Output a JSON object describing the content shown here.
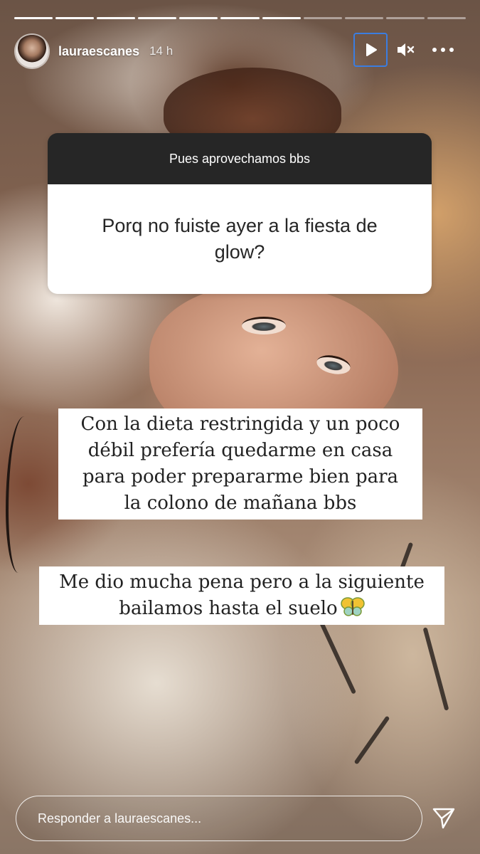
{
  "story": {
    "progress": {
      "segments_total": 11,
      "segments_viewed": 7
    },
    "header": {
      "username": "lauraescanes",
      "time_ago": "14 h",
      "play_icon": "play-icon",
      "mute_icon": "speaker-muted-icon",
      "more_icon": "more-horizontal-icon"
    },
    "question_sticker": {
      "prompt": "Pues aprovechamos bbs",
      "question": "Porq no fuiste ayer a la fiesta de glow?"
    },
    "captions": [
      "Con la dieta restringida y un poco",
      "débil prefería quedarme en casa",
      "para poder prepararme bien para",
      "la colono de mañana bbs",
      "Me dio mucha pena pero a la siguiente",
      "bailamos hasta el suelo"
    ],
    "caption_emoji": "butterfly-icon",
    "reply": {
      "placeholder": "Responder a lauraescanes...",
      "send_icon": "send-icon"
    }
  }
}
